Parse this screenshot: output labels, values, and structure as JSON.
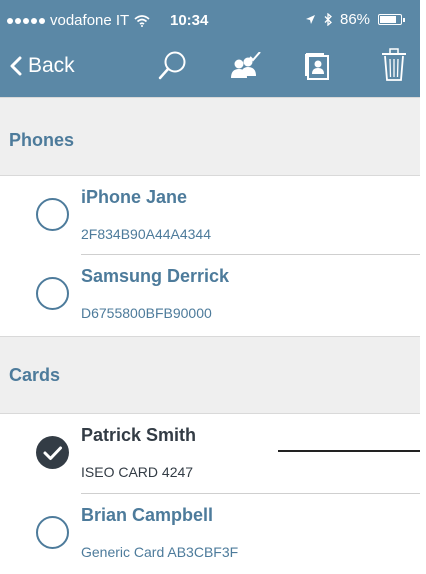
{
  "status_bar": {
    "carrier": "vodafone IT",
    "time": "10:34",
    "battery": "86%",
    "battery_level": 0.86
  },
  "nav": {
    "back_label": "Back",
    "icons": [
      "search-icon",
      "select-users-icon",
      "contact-card-icon",
      "trash-icon"
    ]
  },
  "sections": [
    {
      "title": "Phones",
      "items": [
        {
          "name": "iPhone Jane",
          "detail": "2F834B90A44A4344",
          "selected": false
        },
        {
          "name": "Samsung Derrick",
          "detail": "D6755800BFB90000",
          "selected": false
        }
      ]
    },
    {
      "title": "Cards",
      "items": [
        {
          "name": "Patrick Smith",
          "detail": "ISEO CARD 4247",
          "selected": true
        },
        {
          "name": "Brian Campbell",
          "detail": "Generic Card AB3CBF3F",
          "selected": false
        }
      ]
    }
  ],
  "colors": {
    "header": "#5b88a6",
    "accent": "#4d7b9b",
    "section_bg": "#efefef",
    "selected_text": "#333c45"
  }
}
